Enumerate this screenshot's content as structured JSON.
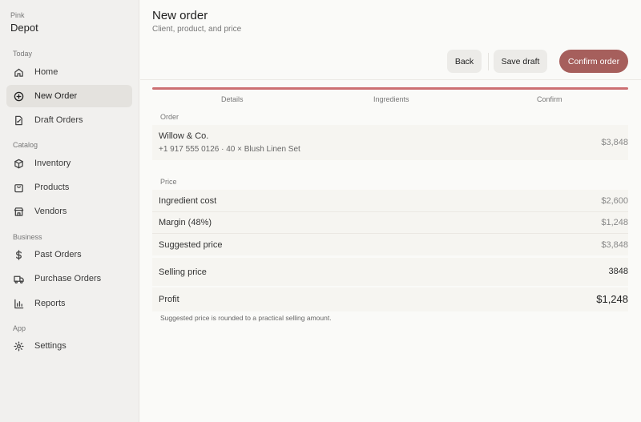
{
  "brand": {
    "top": "Pink",
    "main": "Depot"
  },
  "sidebar": {
    "sections": [
      {
        "label": "Today"
      },
      {
        "label": "Catalog"
      },
      {
        "label": "Business"
      },
      {
        "label": "App"
      }
    ],
    "items": [
      {
        "label": "Home",
        "icon": "home-icon"
      },
      {
        "label": "New Order",
        "icon": "plus-circle-icon",
        "active": true
      },
      {
        "label": "Draft Orders",
        "icon": "draft-doc-icon"
      },
      {
        "label": "Inventory",
        "icon": "box-icon"
      },
      {
        "label": "Products",
        "icon": "bag-icon"
      },
      {
        "label": "Vendors",
        "icon": "store-icon"
      },
      {
        "label": "Past Orders",
        "icon": "dollar-icon"
      },
      {
        "label": "Purchase Orders",
        "icon": "truck-icon"
      },
      {
        "label": "Reports",
        "icon": "bar-chart-icon"
      },
      {
        "label": "Settings",
        "icon": "gear-icon"
      }
    ]
  },
  "header": {
    "title": "New order",
    "subtitle": "Client, product, and price",
    "back_label": "Back",
    "save_label": "Save draft",
    "confirm_label": "Confirm order"
  },
  "steps": [
    "Details",
    "Ingredients",
    "Confirm"
  ],
  "progress": 1.0,
  "order": {
    "group_label": "Order",
    "client": "Willow & Co.",
    "details": "+1 917 555 0126 · 40 × Blush Linen Set",
    "total": "$3,848"
  },
  "price": {
    "group_label": "Price",
    "ingredient_cost_label": "Ingredient cost",
    "ingredient_cost": "$2,600",
    "margin_label": "Margin (48%)",
    "margin": "$1,248",
    "suggested_label": "Suggested price",
    "suggested": "$3,848",
    "selling_label": "Selling price",
    "selling_value": "3848",
    "profit_label": "Profit",
    "profit": "$1,248",
    "note": "Suggested price is rounded to a practical selling amount."
  },
  "colors": {
    "accent": "#a65f5c",
    "progress": "#cc6f72",
    "sidebar_bg": "#f1f0ee",
    "active_bg": "#e4e2de"
  }
}
